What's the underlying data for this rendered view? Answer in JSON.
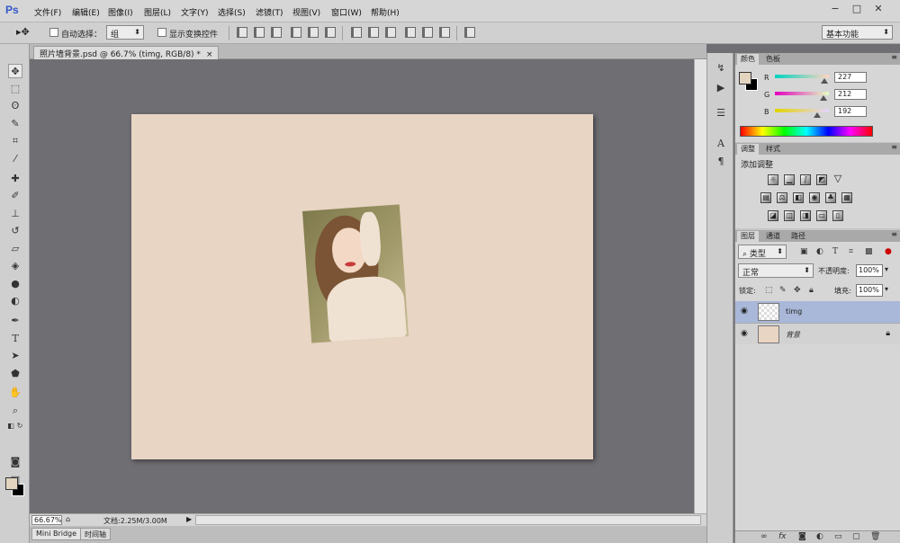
{
  "app": {
    "logo": "Ps"
  },
  "menu": {
    "items": [
      "文件(F)",
      "编辑(E)",
      "图像(I)",
      "图层(L)",
      "文字(Y)",
      "选择(S)",
      "滤镜(T)",
      "视图(V)",
      "窗口(W)",
      "帮助(H)"
    ]
  },
  "window_controls": {
    "minimize": "−",
    "maximize": "□",
    "close": "✕"
  },
  "options_bar": {
    "auto_select_label": "自动选择：",
    "auto_select_value": "组",
    "show_transform_label": "显示变换控件",
    "workspace": "基本功能"
  },
  "document": {
    "tab_title": "照片墙背景.psd @ 66.7% (timg, RGB/8) *",
    "close": "×",
    "background_color": "#e8d5c3"
  },
  "status": {
    "zoom": "66.67%",
    "doc_size": "文档:2.25M/3.00M"
  },
  "bottom_tabs": [
    "Mini Bridge",
    "时间轴"
  ],
  "color_panel": {
    "tabs": [
      "颜色",
      "色板"
    ],
    "r_label": "R",
    "g_label": "G",
    "b_label": "B",
    "r": "227",
    "g": "212",
    "b": "192",
    "foreground": "#e3d4c0",
    "background": "#000000"
  },
  "adjustments_panel": {
    "tabs": [
      "调整",
      "样式"
    ],
    "title": "添加调整"
  },
  "layers_panel": {
    "tabs": [
      "图层",
      "通道",
      "路径"
    ],
    "filter_kind": "类型",
    "blend_mode": "正常",
    "opacity_label": "不透明度:",
    "opacity": "100%",
    "lock_label": "锁定:",
    "fill_label": "填充:",
    "fill": "100%",
    "layers": [
      {
        "name": "timg",
        "selected": true
      },
      {
        "name": "背景",
        "selected": false,
        "locked": true
      }
    ]
  },
  "icons": {
    "tools": [
      "move-tool-icon",
      "marquee-tool-icon",
      "lasso-tool-icon",
      "quick-select-tool-icon",
      "crop-tool-icon",
      "eyedropper-tool-icon",
      "healing-brush-icon",
      "brush-tool-icon",
      "clone-stamp-icon",
      "history-brush-icon",
      "eraser-tool-icon",
      "paint-bucket-icon",
      "blur-tool-icon",
      "dodge-tool-icon",
      "pen-tool-icon",
      "type-tool-icon",
      "path-select-icon",
      "shape-tool-icon",
      "hand-tool-icon",
      "zoom-tool-icon"
    ]
  }
}
